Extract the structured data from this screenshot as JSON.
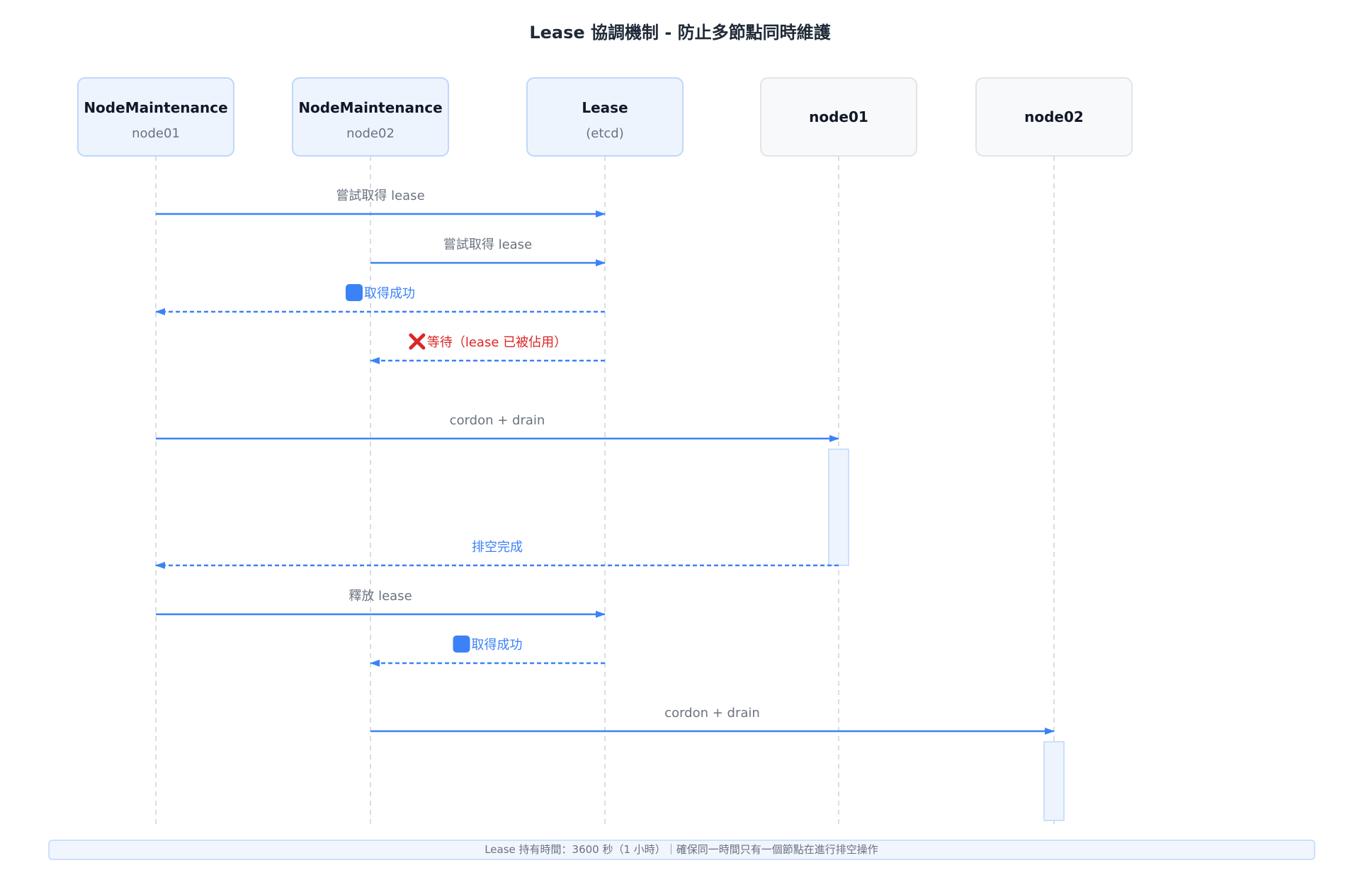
{
  "title": "Lease 協調機制 - 防止多節點同時維護",
  "colors": {
    "accent": "#3b82f6",
    "error": "#dc2626",
    "label_gray": "#6b7280",
    "box_blue_fill": "#eef4fe",
    "box_blue_stroke": "#bfd7fb",
    "box_gray_fill": "#f8f9fa",
    "box_gray_stroke": "#e2e4e8",
    "activation_fill": "#eef4fe",
    "activation_stroke": "#bfd7fb"
  },
  "participants": [
    {
      "id": "nm1",
      "title": "NodeMaintenance",
      "subtitle": "node01",
      "style": "blue"
    },
    {
      "id": "nm2",
      "title": "NodeMaintenance",
      "subtitle": "node02",
      "style": "blue"
    },
    {
      "id": "lease",
      "title": "Lease",
      "subtitle": "(etcd)",
      "style": "blue"
    },
    {
      "id": "node01",
      "title": "node01",
      "subtitle": "",
      "style": "gray"
    },
    {
      "id": "node02",
      "title": "node02",
      "subtitle": "",
      "style": "gray"
    }
  ],
  "messages": [
    {
      "from": "nm1",
      "to": "lease",
      "label": "嘗試取得 lease",
      "kind": "request",
      "icon": ""
    },
    {
      "from": "nm2",
      "to": "lease",
      "label": "嘗試取得 lease",
      "kind": "request",
      "icon": ""
    },
    {
      "from": "lease",
      "to": "nm1",
      "label": "取得成功",
      "kind": "reply",
      "icon": "blue-square-icon"
    },
    {
      "from": "lease",
      "to": "nm2",
      "label": "等待（lease 已被佔用）",
      "kind": "error-reply",
      "icon": "cross-mark-icon"
    },
    {
      "from": "nm1",
      "to": "node01",
      "label": "cordon + drain",
      "kind": "request",
      "icon": ""
    },
    {
      "from": "node01",
      "to": "nm1",
      "label": "排空完成",
      "kind": "reply",
      "icon": ""
    },
    {
      "from": "nm1",
      "to": "lease",
      "label": "釋放 lease",
      "kind": "request",
      "icon": ""
    },
    {
      "from": "lease",
      "to": "nm2",
      "label": "取得成功",
      "kind": "reply",
      "icon": "blue-square-icon"
    },
    {
      "from": "nm2",
      "to": "node02",
      "label": "cordon + drain",
      "kind": "request",
      "icon": ""
    }
  ],
  "activations": [
    {
      "participant": "node01",
      "from_message": 4,
      "to_message": 5
    },
    {
      "participant": "node02",
      "from_message": 8,
      "to_message": "end"
    }
  ],
  "footer": {
    "text": "Lease 持有時間：3600 秒（1 小時）｜確保同一時間只有一個節點在進行排空操作"
  }
}
